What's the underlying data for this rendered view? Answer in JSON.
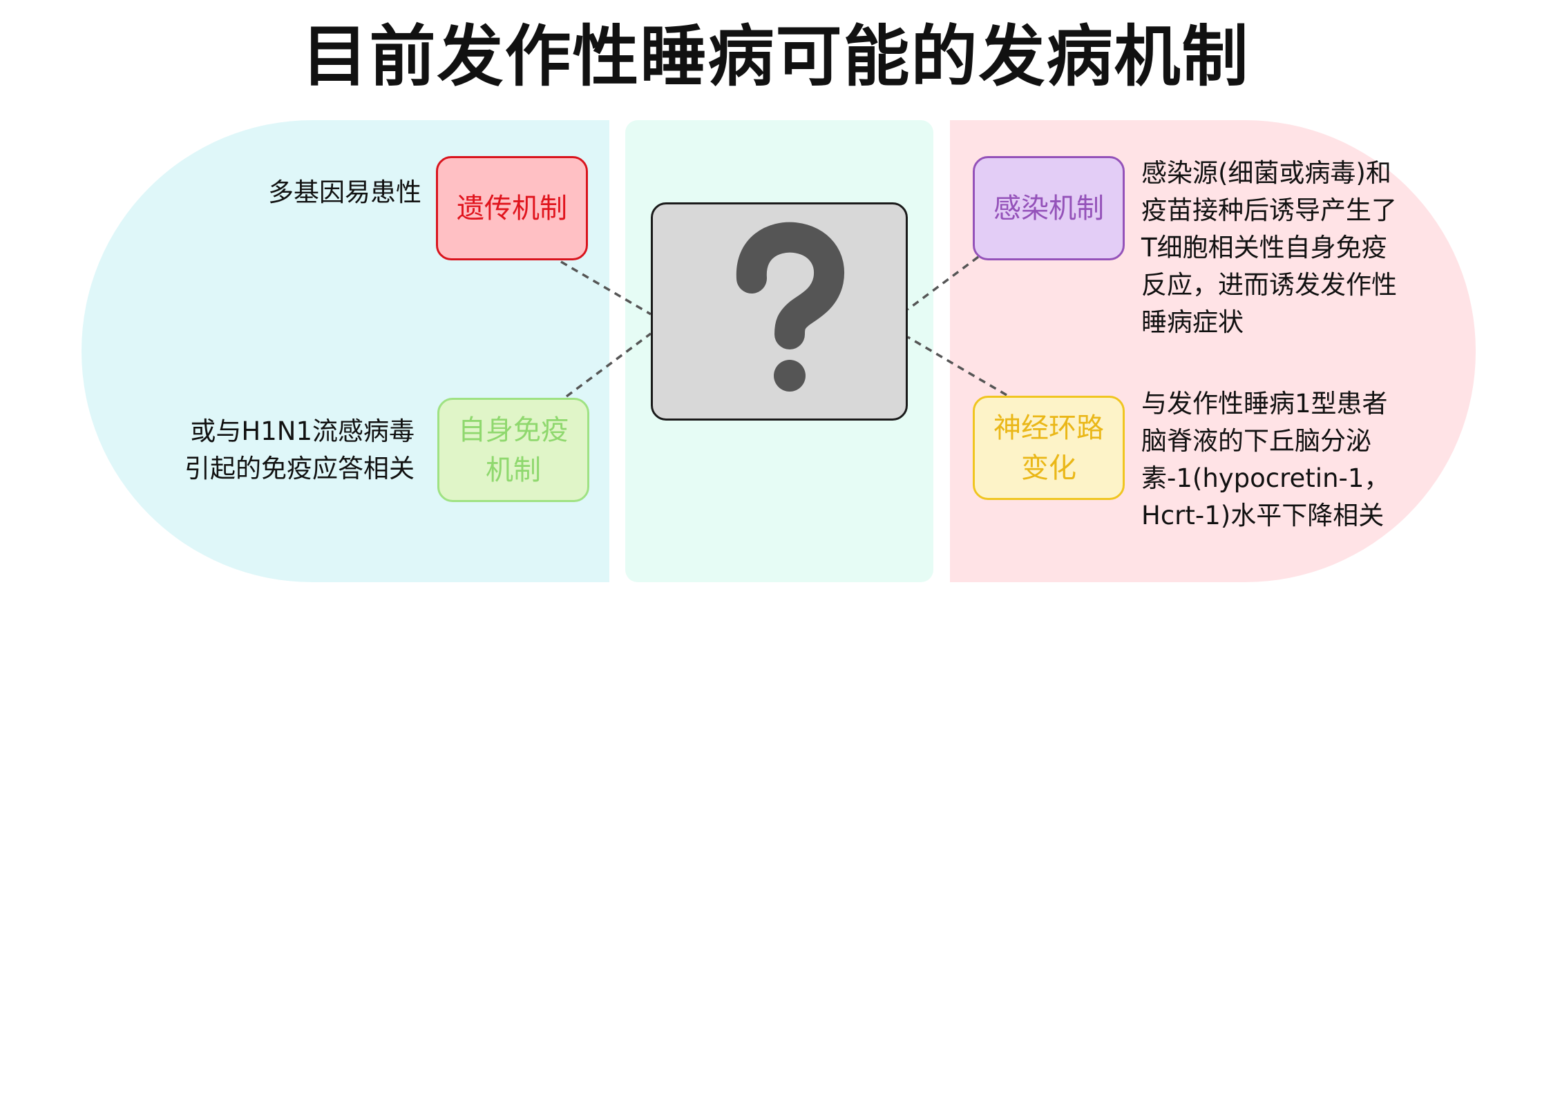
{
  "title": "目前发作性睡病可能的发病机制",
  "center": {
    "icon": "question-mark-icon"
  },
  "nodes": {
    "genetic": {
      "label": "遗传机制",
      "desc": [
        "多基因易患性"
      ]
    },
    "autoimmune": {
      "label_lines": [
        "自身免疫",
        "机制"
      ],
      "desc": [
        "或与H1N1流感病毒",
        "引起的免疫应答相关"
      ]
    },
    "infection": {
      "label": "感染机制",
      "desc": [
        "感染源(细菌或病毒)和",
        "疫苗接种后诱导产生了",
        "T细胞相关性自身免疫",
        "反应，进而诱发发作性",
        "睡病症状"
      ]
    },
    "neural": {
      "label_lines": [
        "神经环路",
        "变化"
      ],
      "desc": [
        "与发作性睡病1型患者",
        "脑脊液的下丘脑分泌",
        "素-1(hypocretin-1，",
        "Hcrt-1)水平下降相关"
      ]
    }
  },
  "colors": {
    "left_panel": "#dff7f9",
    "center_panel": "#e6fcf5",
    "right_panel": "#ffe3e6",
    "genetic": "#d9141d",
    "autoimmune": "#9fe283",
    "infection": "#9452b9",
    "neural": "#f0c520",
    "question_box": "#d8d8d8"
  }
}
